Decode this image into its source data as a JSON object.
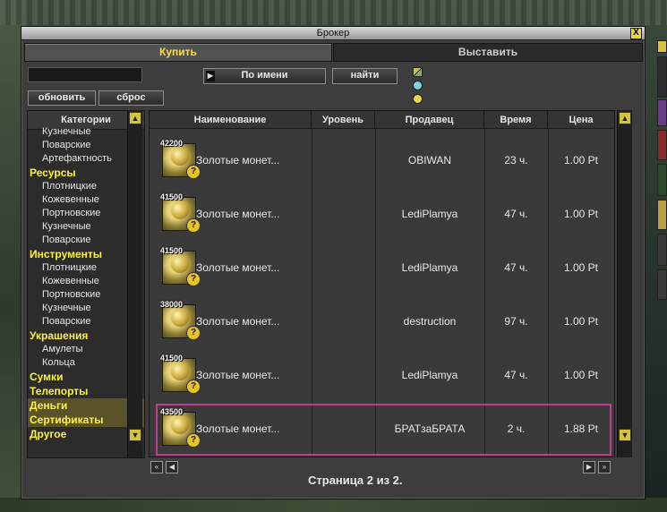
{
  "window": {
    "title": "Брокер",
    "close_label": "X"
  },
  "tabs": [
    {
      "label": "Купить",
      "active": true
    },
    {
      "label": "Выставить",
      "active": false
    }
  ],
  "search": {
    "value": "",
    "placeholder": ""
  },
  "buttons": {
    "refresh": "обновить",
    "reset": "сброс",
    "sort": "По имени",
    "find": "найти"
  },
  "categories": {
    "header": "Категории",
    "items": [
      {
        "label": "Кузнечные",
        "level": 2
      },
      {
        "label": "Поварские",
        "level": 2
      },
      {
        "label": "Артефактность",
        "level": 2
      },
      {
        "label": "Ресурсы",
        "level": 1
      },
      {
        "label": "Плотницкие",
        "level": 2
      },
      {
        "label": "Кожевенные",
        "level": 2
      },
      {
        "label": "Портновские",
        "level": 2
      },
      {
        "label": "Кузнечные",
        "level": 2
      },
      {
        "label": "Поварские",
        "level": 2
      },
      {
        "label": "Инструменты",
        "level": 1
      },
      {
        "label": "Плотницкие",
        "level": 2
      },
      {
        "label": "Кожевенные",
        "level": 2
      },
      {
        "label": "Портновские",
        "level": 2
      },
      {
        "label": "Кузнечные",
        "level": 2
      },
      {
        "label": "Поварские",
        "level": 2
      },
      {
        "label": "Украшения",
        "level": 1
      },
      {
        "label": "Амулеты",
        "level": 2
      },
      {
        "label": "Кольца",
        "level": 2
      },
      {
        "label": "Сумки",
        "level": 1
      },
      {
        "label": "Телепорты",
        "level": 1
      },
      {
        "label": "Деньги",
        "level": 1,
        "highlighted": true
      },
      {
        "label": "Сертификаты",
        "level": 1,
        "highlighted": true
      },
      {
        "label": "Другое",
        "level": 1
      }
    ]
  },
  "table": {
    "columns": [
      "Наименование",
      "Уровень",
      "Продавец",
      "Время",
      "Цена"
    ],
    "rows": [
      {
        "qty": "42200",
        "name": "Золотые монет...",
        "level": "",
        "seller": "OBIWAN",
        "time": "23 ч.",
        "price": "1.00 Pt",
        "selected": false
      },
      {
        "qty": "41500",
        "name": "Золотые монет...",
        "level": "",
        "seller": "LediPlamya",
        "time": "47 ч.",
        "price": "1.00 Pt",
        "selected": false
      },
      {
        "qty": "41500",
        "name": "Золотые монет...",
        "level": "",
        "seller": "LediPlamya",
        "time": "47 ч.",
        "price": "1.00 Pt",
        "selected": false
      },
      {
        "qty": "38000",
        "name": "Золотые монет...",
        "level": "",
        "seller": "destruction",
        "time": "97 ч.",
        "price": "1.00 Pt",
        "selected": false
      },
      {
        "qty": "41500",
        "name": "Золотые монет...",
        "level": "",
        "seller": "LediPlamya",
        "time": "47 ч.",
        "price": "1.00 Pt",
        "selected": false
      },
      {
        "qty": "43500",
        "name": "Золотые монет...",
        "level": "",
        "seller": "БРАТзаБРАТА",
        "time": "2 ч.",
        "price": "1.88 Pt",
        "selected": true
      }
    ]
  },
  "pager": {
    "text": "Страница 2 из 2."
  },
  "icons": {
    "item_icon": "gold-coins-icon",
    "info": "question-icon",
    "scroll_up": "arrow-up-icon",
    "scroll_down": "arrow-down-icon"
  },
  "colors": {
    "accent": "#ffd94a",
    "category_top": "#fff23d",
    "selection": "#c03c8c",
    "panel": "#3d3d3d"
  }
}
